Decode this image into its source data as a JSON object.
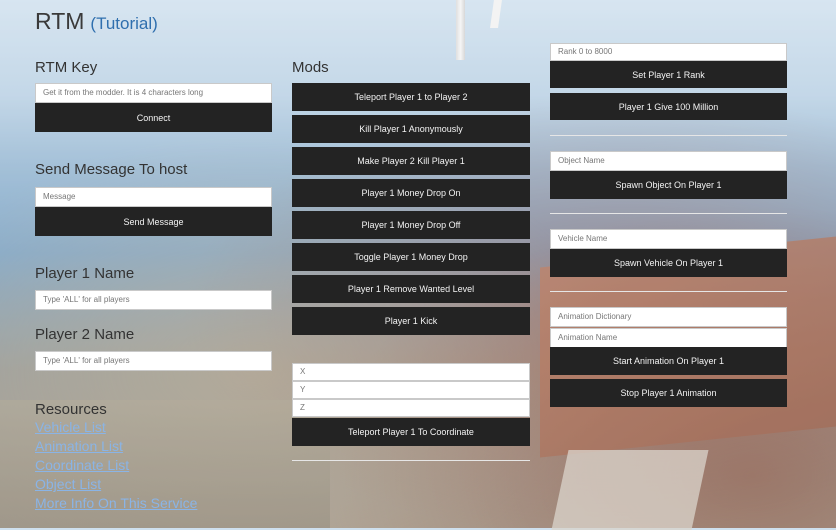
{
  "header": {
    "title": "RTM",
    "tutorial_link": "Tutorial"
  },
  "left": {
    "rtm_key": {
      "heading": "RTM Key",
      "placeholder": "Get it from the modder. It is 4 characters long",
      "button": "Connect"
    },
    "send_message": {
      "heading": "Send Message To host",
      "placeholder": "Message",
      "button": "Send Message"
    },
    "player1": {
      "heading": "Player 1 Name",
      "placeholder": "Type 'ALL' for all players"
    },
    "player2": {
      "heading": "Player 2 Name",
      "placeholder": "Type 'ALL' for all players"
    },
    "resources": {
      "heading": "Resources",
      "links": [
        "Vehicle List",
        "Animation List",
        "Coordinate List",
        "Object List",
        "More Info On This Service"
      ]
    }
  },
  "middle": {
    "heading": "Mods",
    "buttons": [
      "Teleport Player 1 to Player 2",
      "Kill Player 1 Anonymously",
      "Make Player 2 Kill Player 1",
      "Player 1 Money Drop On",
      "Player 1 Money Drop Off",
      "Toggle Player 1 Money Drop",
      "Player 1 Remove Wanted Level",
      "Player 1 Kick"
    ],
    "coords": {
      "x_placeholder": "X",
      "y_placeholder": "Y",
      "z_placeholder": "Z",
      "button": "Teleport Player 1 To Coordinate"
    }
  },
  "right": {
    "rank": {
      "placeholder": "Rank 0 to 8000",
      "button": "Set Player 1 Rank",
      "money_button": "Player 1 Give 100 Million"
    },
    "object": {
      "placeholder": "Object Name",
      "button": "Spawn Object On Player 1"
    },
    "vehicle": {
      "placeholder": "Vehicle Name",
      "button": "Spawn Vehicle On Player 1"
    },
    "animation": {
      "dict_placeholder": "Animation Dictionary",
      "name_placeholder": "Animation Name",
      "start_button": "Start Animation On Player 1",
      "stop_button": "Stop Player 1 Animation"
    }
  },
  "colors": {
    "button_bg": "#232323",
    "link": "#8ab4e6",
    "accent": "#2f6fae"
  }
}
